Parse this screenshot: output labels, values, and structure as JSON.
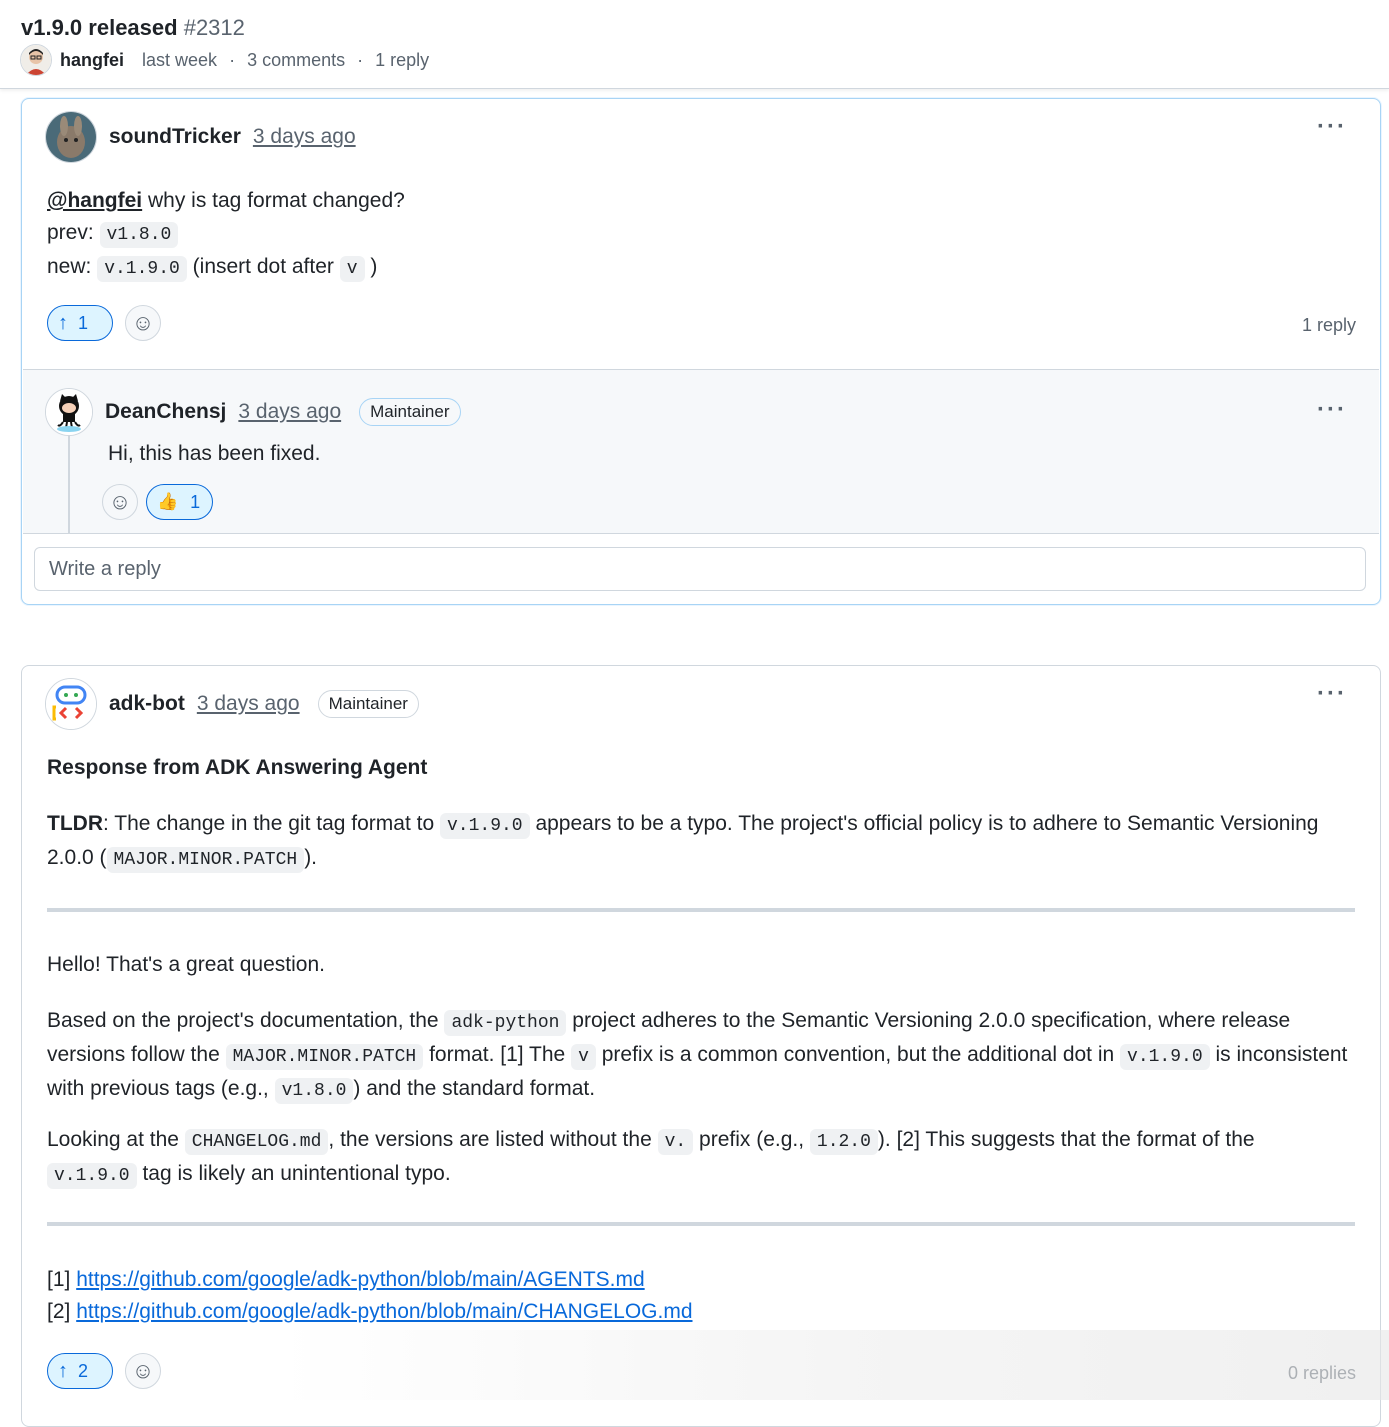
{
  "discussion": {
    "title": "v1.9.0 released",
    "number": "#2312",
    "author": "hangfei",
    "time": "last week",
    "comments": "3 comments",
    "replies": "1 reply"
  },
  "comment1": {
    "author": "soundTricker",
    "time": "3 days ago",
    "mention": "@hangfei",
    "line1_rest": " why is tag format changed?",
    "prev_label": "prev: ",
    "prev_code": "v1.8.0",
    "new_label": "new: ",
    "new_code": "v.1.9.0",
    "insert_text": " (insert dot after ",
    "insert_code": "v",
    "insert_end": " )",
    "upvotes": "1",
    "reply_count": "1 reply"
  },
  "reply1": {
    "author": "DeanChensj",
    "time": "3 days ago",
    "badge": "Maintainer",
    "text": "Hi, this has been fixed.",
    "thumbs_count": "1",
    "thumbs_emoji": "👍"
  },
  "reply_input": {
    "placeholder": "Write a reply"
  },
  "comment2": {
    "author": "adk-bot",
    "time": "3 days ago",
    "badge": "Maintainer",
    "heading": "Response from ADK Answering Agent",
    "tldr_label": "TLDR",
    "tldr_a": ": The change in the git tag format to ",
    "tldr_code1": "v.1.9.0",
    "tldr_b": " appears to be a typo. The project's official policy is to adhere to Semantic Versioning 2.0.0 (",
    "tldr_code2": "MAJOR.MINOR.PATCH",
    "tldr_c": ").",
    "hello": "Hello! That's a great question.",
    "p2_a": "Based on the project's documentation, the ",
    "p2_code1": "adk-python",
    "p2_b": " project adheres to the Semantic Versioning 2.0.0 specification, where release versions follow the ",
    "p2_code2": "MAJOR.MINOR.PATCH",
    "p2_c": " format. [1] The ",
    "p2_code3": "v",
    "p2_d": " prefix is a common convention, but the additional dot in ",
    "p2_code4": "v.1.9.0",
    "p2_e": " is inconsistent with previous tags (e.g., ",
    "p2_code5": "v1.8.0",
    "p2_f": ") and the standard format.",
    "p3_a": "Looking at the ",
    "p3_code1": "CHANGELOG.md",
    "p3_b": ", the versions are listed without the ",
    "p3_code2": "v.",
    "p3_c": " prefix (e.g., ",
    "p3_code3": "1.2.0",
    "p3_d": "). [2] This suggests that the format of the ",
    "p3_code4": "v.1.9.0",
    "p3_e": " tag is likely an unintentional typo.",
    "ref1_label": "[1] ",
    "ref1_url": "https://github.com/google/adk-python/blob/main/AGENTS.md",
    "ref2_label": "[2] ",
    "ref2_url": "https://github.com/google/adk-python/blob/main/CHANGELOG.md",
    "upvotes": "2",
    "reply_count": "0 replies"
  },
  "icons": {
    "kebab": "kebab-horizontal-icon",
    "upvote": "arrow-up-icon",
    "emoji": "smiley-icon"
  },
  "colors": {
    "link": "#0969da",
    "upvote_bg": "#ddf4ff",
    "border": "#d0d7de"
  }
}
